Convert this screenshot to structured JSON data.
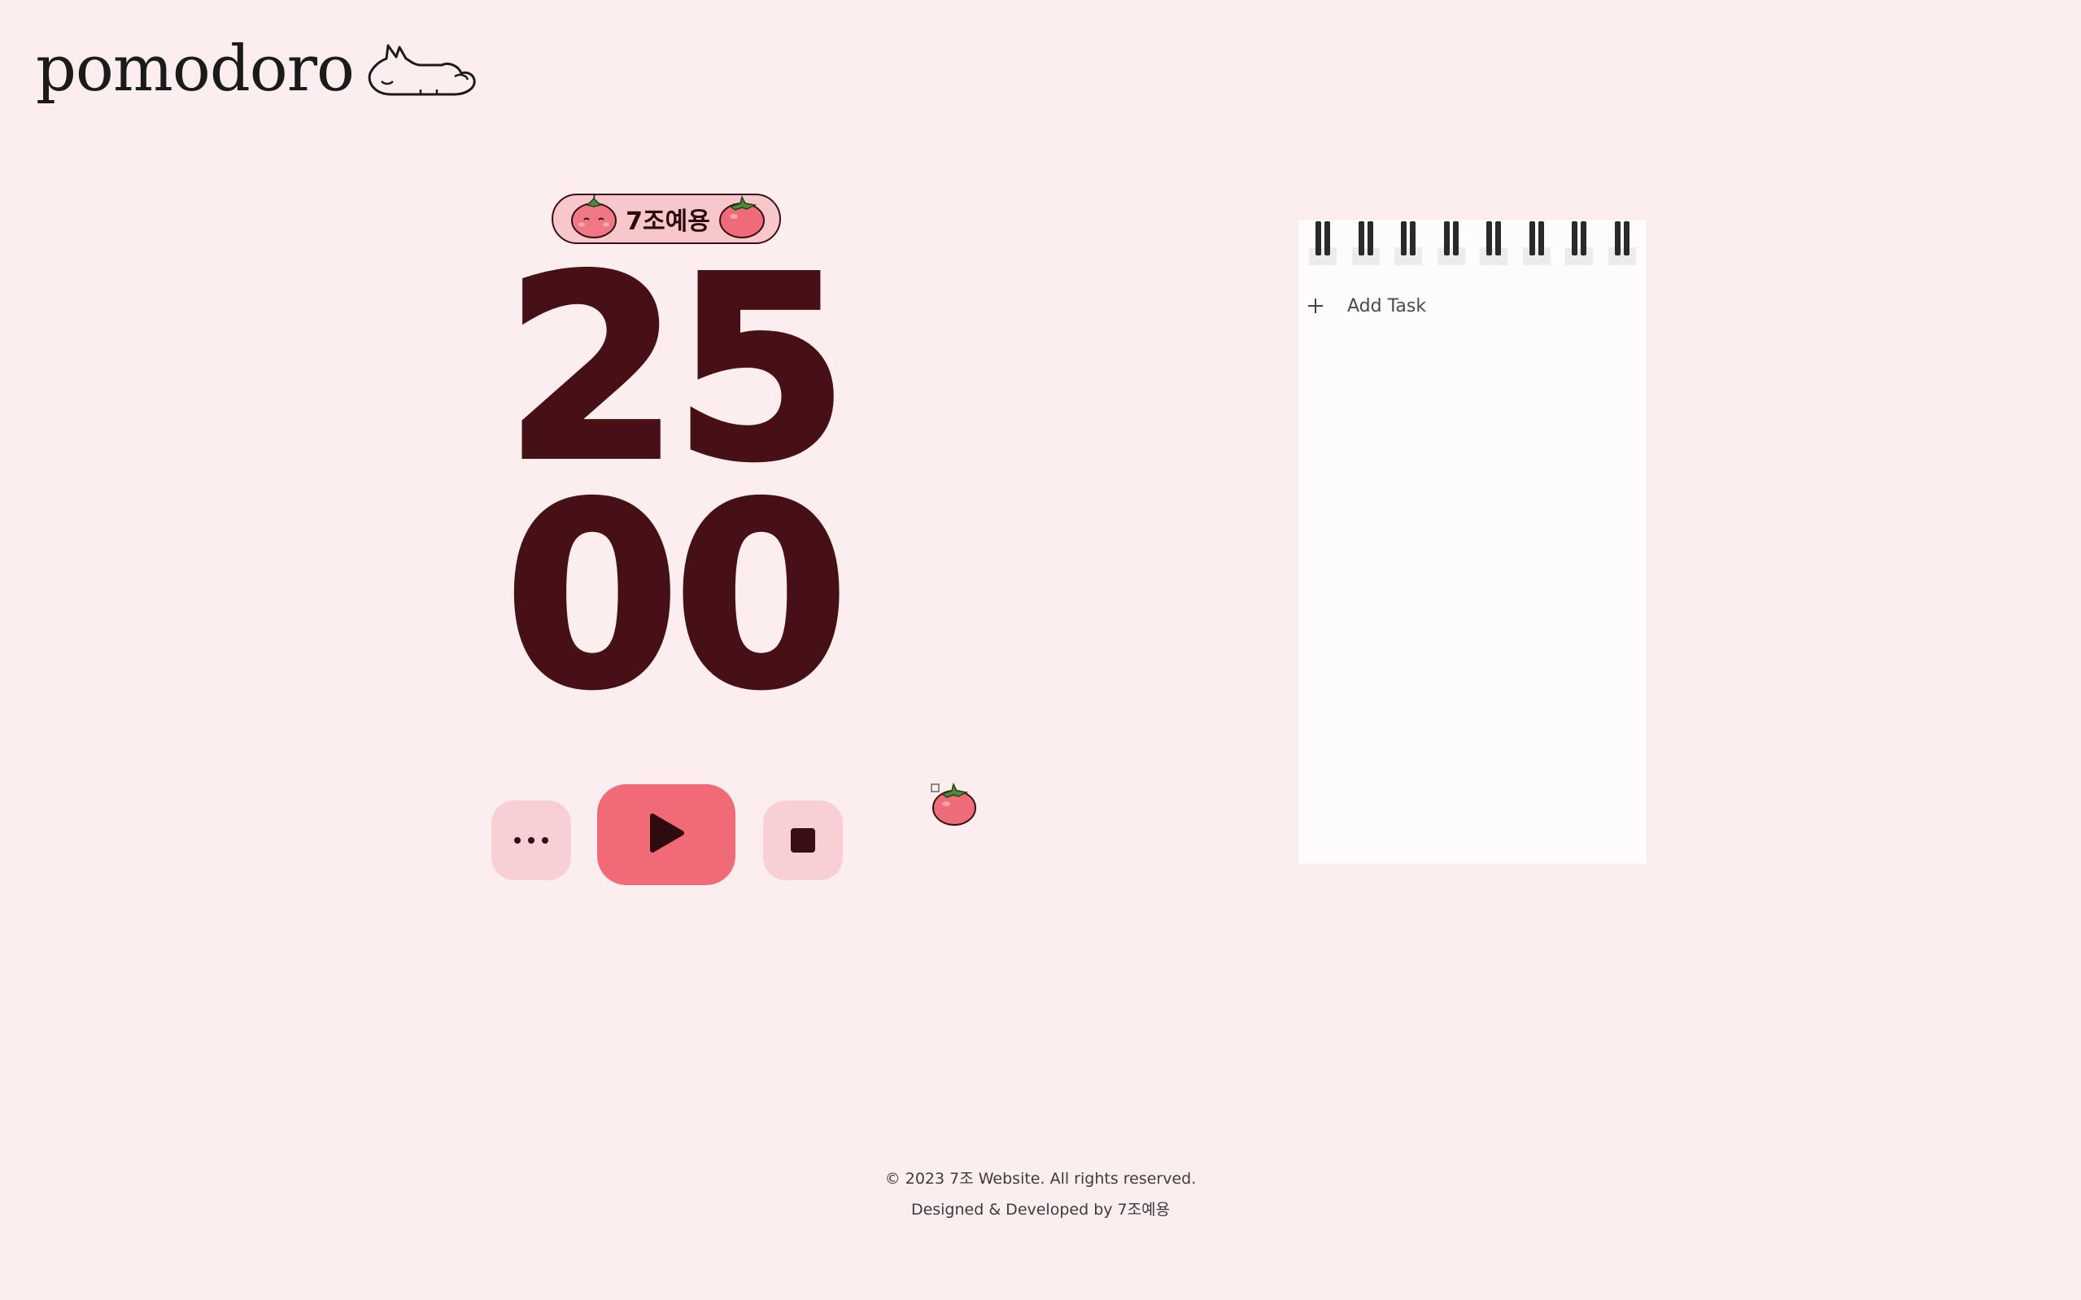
{
  "header": {
    "logo_text": "pomodoro",
    "logo_icon": "sleeping-cat-icon"
  },
  "timer": {
    "badge_label": "7조예용",
    "badge_icons": [
      "tomato-face-icon",
      "tomato-icon"
    ],
    "minutes": "25",
    "seconds": "00"
  },
  "controls": {
    "more_icon": "ellipsis-icon",
    "play_icon": "play-icon",
    "stop_icon": "stop-icon"
  },
  "tasks": {
    "add_task_label": "Add Task"
  },
  "footer": {
    "copyright": "© 2023 7조 Website. All rights reserved.",
    "credits": "Designed & Developed by 7조예용"
  },
  "colors": {
    "background": "#fcedef",
    "timer_text": "#461016",
    "play_button": "#f06a78",
    "secondary_button": "#f8cfd5",
    "badge_bg": "#f7c7cc",
    "notepad_bg": "#fdfbfb"
  }
}
